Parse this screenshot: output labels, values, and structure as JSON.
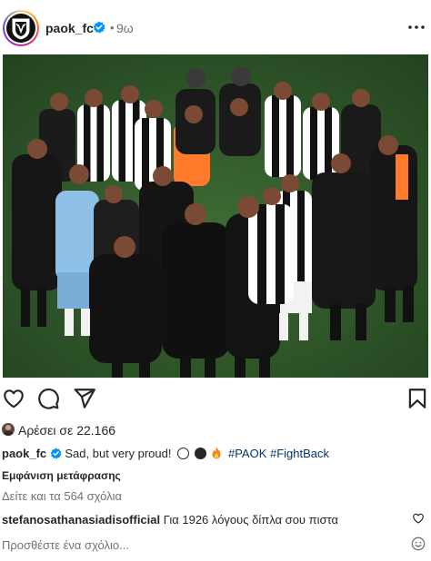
{
  "post": {
    "username": "paok_fc",
    "time_separator": "•",
    "time": "9ω",
    "likes_text": "Αρέσει σε 22.166",
    "caption": {
      "username": "paok_fc",
      "text": "Sad, but very proud!",
      "hashtag_1": "#PAOK",
      "hashtag_2": "#FightBack"
    },
    "translation_link": "Εμφάνιση μετάφρασης",
    "view_comments": "Δείτε και τα 564 σχόλια",
    "top_comment": {
      "username": "stefanosathanasiadisofficial",
      "text": "Για 1926 λόγους δίπλα σου πιστα"
    },
    "add_comment_placeholder": "Προσθέστε ένα σχόλιο..."
  },
  "icons": {
    "verified": "verified-badge-icon",
    "more": "more-options-icon",
    "like": "heart-icon",
    "comment": "comment-icon",
    "share": "paper-plane-icon",
    "save": "bookmark-icon",
    "emoji": "smiley-icon",
    "caption_emojis": [
      "white-circle-emoji",
      "black-circle-emoji",
      "fire-emoji"
    ]
  },
  "colors": {
    "verified_blue": "#0095f6",
    "hashtag_link": "#00376b",
    "secondary_text": "#737373",
    "primary_text": "#262626",
    "pitch_green": "#2f5a2a"
  }
}
